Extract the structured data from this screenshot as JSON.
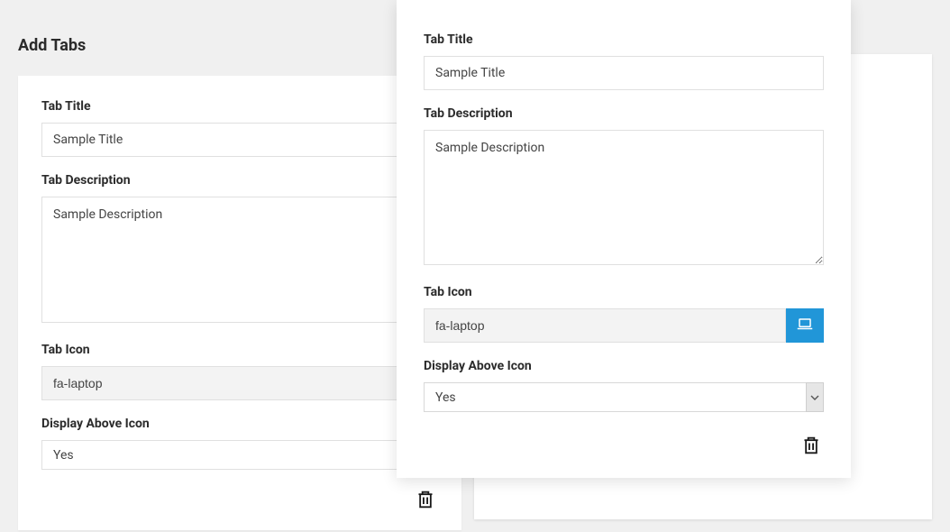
{
  "page_title": "Add Tabs",
  "labels": {
    "tab_title": "Tab Title",
    "tab_description": "Tab Description",
    "tab_icon": "Tab Icon",
    "display_above_icon": "Display Above Icon"
  },
  "card_back": {
    "title_value": "Sample Title",
    "description_value": "Sample Description",
    "icon_value": "fa-laptop",
    "display_above_value": "Yes"
  },
  "card_front": {
    "title_value": "Sample Title",
    "description_value": "Sample Description",
    "icon_value": "fa-laptop",
    "display_above_value": "Yes"
  }
}
